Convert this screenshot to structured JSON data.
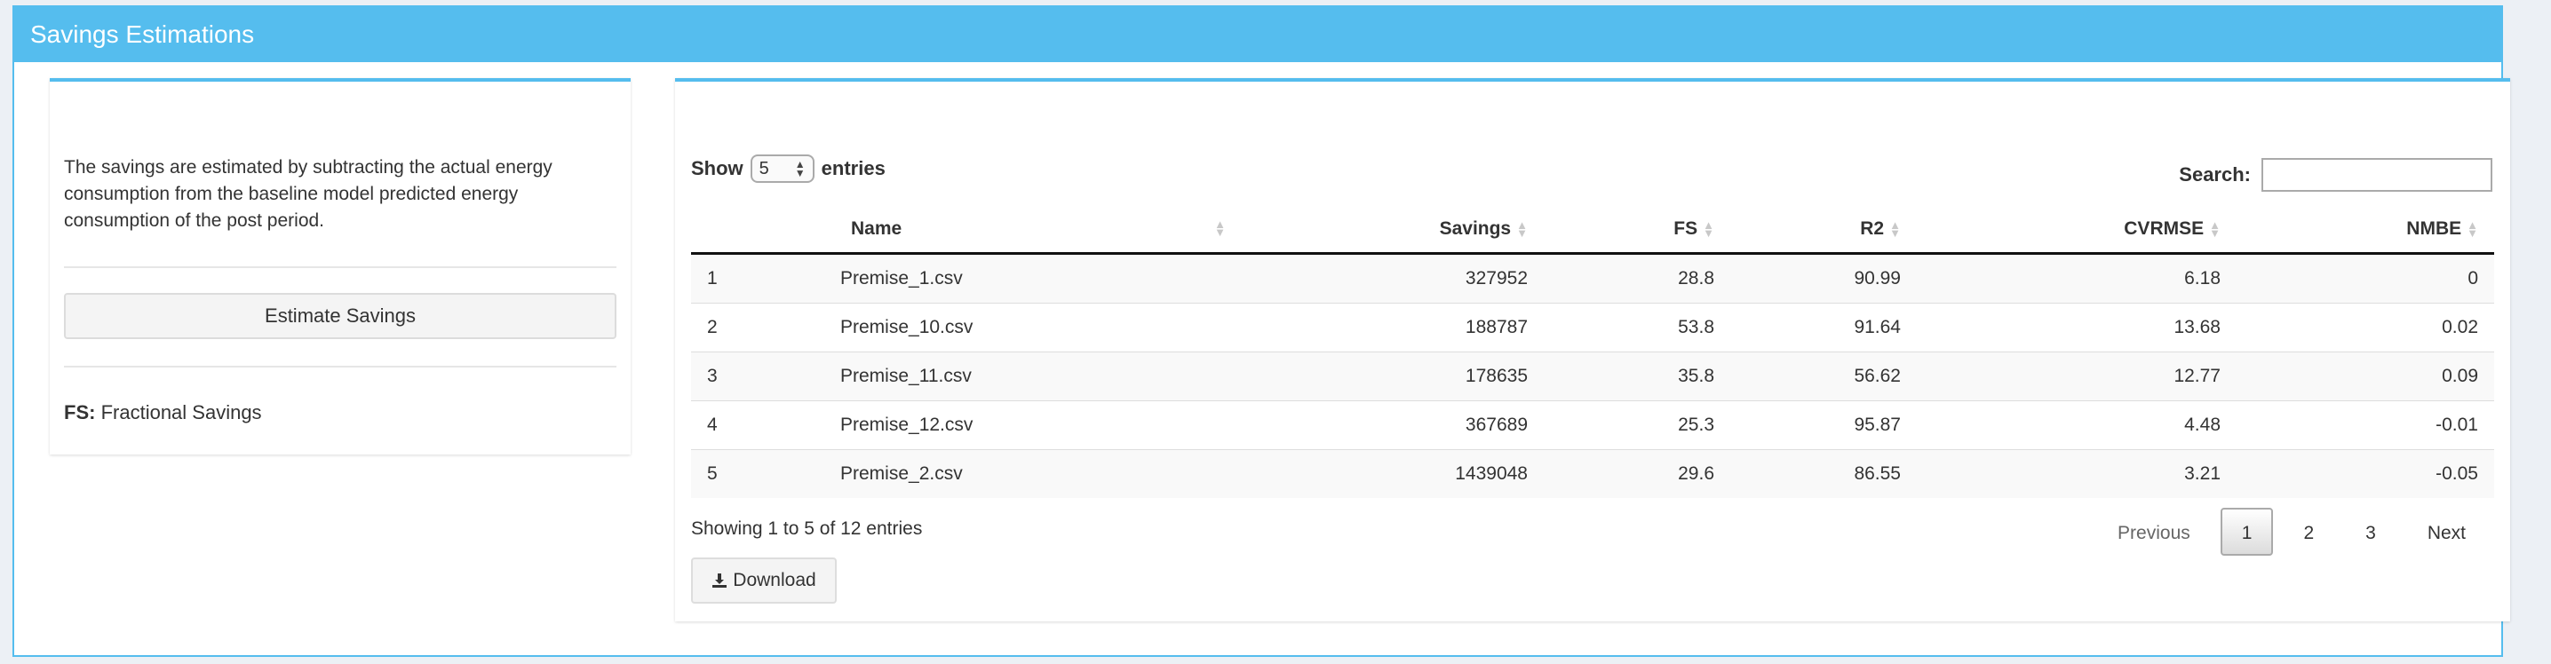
{
  "header": {
    "title": "Savings Estimations"
  },
  "sidebar": {
    "description": "The savings are estimated by subtracting the actual energy consumption from the baseline model predicted energy consumption of the post period.",
    "estimate_label": "Estimate Savings",
    "fs_key": "FS:",
    "fs_value": "Fractional Savings"
  },
  "table_controls": {
    "show_label": "Show",
    "page_size": "5",
    "entries_label": "entries",
    "search_label": "Search:",
    "search_value": ""
  },
  "table": {
    "columns": [
      "",
      "Name",
      "Savings",
      "FS",
      "R2",
      "CVRMSE",
      "NMBE"
    ],
    "rows": [
      [
        "1",
        "Premise_1.csv",
        "327952",
        "28.8",
        "90.99",
        "6.18",
        "0"
      ],
      [
        "2",
        "Premise_10.csv",
        "188787",
        "53.8",
        "91.64",
        "13.68",
        "0.02"
      ],
      [
        "3",
        "Premise_11.csv",
        "178635",
        "35.8",
        "56.62",
        "12.77",
        "0.09"
      ],
      [
        "4",
        "Premise_12.csv",
        "367689",
        "25.3",
        "95.87",
        "4.48",
        "-0.01"
      ],
      [
        "5",
        "Premise_2.csv",
        "1439048",
        "29.6",
        "86.55",
        "3.21",
        "-0.05"
      ]
    ]
  },
  "footer": {
    "info": "Showing 1 to 5 of 12 entries",
    "pagination": {
      "previous": "Previous",
      "pages": [
        "1",
        "2",
        "3"
      ],
      "next": "Next"
    },
    "download_label": "Download"
  },
  "colors": {
    "accent": "#55bdee",
    "background": "#ecf0f5"
  }
}
